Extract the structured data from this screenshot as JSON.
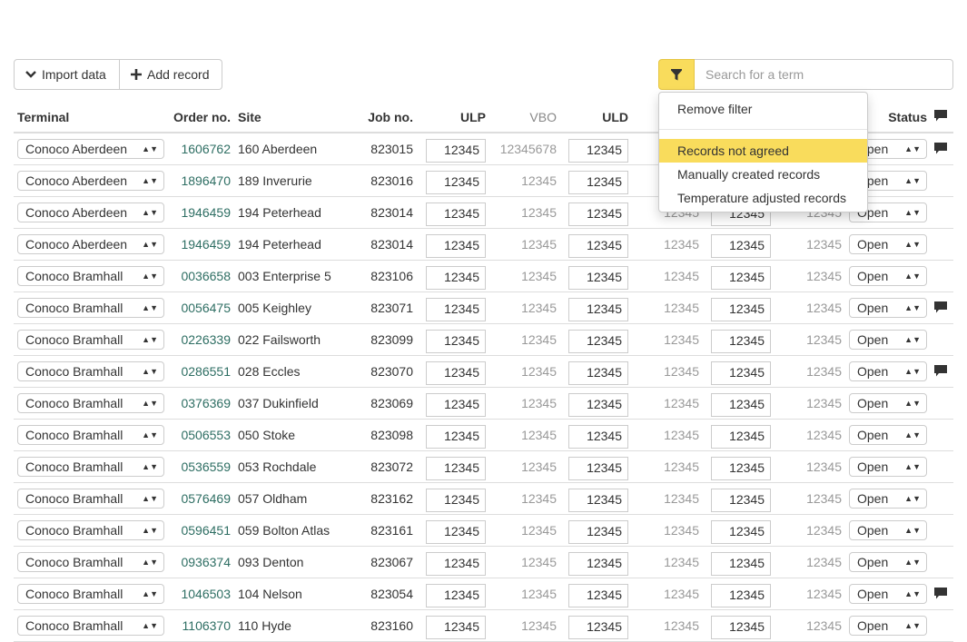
{
  "toolbar": {
    "import_label": "Import data",
    "add_label": "Add record"
  },
  "search": {
    "placeholder": "Search for a term"
  },
  "filter_menu": {
    "remove": "Remove filter",
    "options": [
      "Records not agreed",
      "Manually created records",
      "Temperature adjusted records"
    ],
    "active_option": "Records not agreed"
  },
  "columns": {
    "terminal": "Terminal",
    "order": "Order no.",
    "site": "Site",
    "job": "Job no.",
    "ulp": "ULP",
    "vbo": "VBO",
    "uld": "ULD",
    "status": "Status"
  },
  "colors": {
    "accent": "#f9dc5c",
    "order_link": "#2e6e63"
  },
  "rows": [
    {
      "terminal": "Conoco Aberdeen",
      "order": "1606762",
      "site": "160 Aberdeen",
      "job": "823015",
      "ulp": "12345",
      "vbo": "12345678",
      "uld": "12345",
      "c4": "12345",
      "c5": "12345",
      "c6": "12345",
      "status": "Open",
      "comment": true
    },
    {
      "terminal": "Conoco Aberdeen",
      "order": "1896470",
      "site": "189 Inverurie",
      "job": "823016",
      "ulp": "12345",
      "vbo": "12345",
      "uld": "12345",
      "c4": "12345",
      "c5": "12345",
      "c6": "12345",
      "status": "Open",
      "comment": false
    },
    {
      "terminal": "Conoco Aberdeen",
      "order": "1946459",
      "site": "194 Peterhead",
      "job": "823014",
      "ulp": "12345",
      "vbo": "12345",
      "uld": "12345",
      "c4": "12345",
      "c5": "12345",
      "c6": "12345",
      "status": "Open",
      "comment": false
    },
    {
      "terminal": "Conoco Aberdeen",
      "order": "1946459",
      "site": "194 Peterhead",
      "job": "823014",
      "ulp": "12345",
      "vbo": "12345",
      "uld": "12345",
      "c4": "12345",
      "c5": "12345",
      "c6": "12345",
      "status": "Open",
      "comment": false
    },
    {
      "terminal": "Conoco Bramhall",
      "order": "0036658",
      "site": "003 Enterprise 5",
      "job": "823106",
      "ulp": "12345",
      "vbo": "12345",
      "uld": "12345",
      "c4": "12345",
      "c5": "12345",
      "c6": "12345",
      "status": "Open",
      "comment": false
    },
    {
      "terminal": "Conoco Bramhall",
      "order": "0056475",
      "site": "005 Keighley",
      "job": "823071",
      "ulp": "12345",
      "vbo": "12345",
      "uld": "12345",
      "c4": "12345",
      "c5": "12345",
      "c6": "12345",
      "status": "Open",
      "comment": true
    },
    {
      "terminal": "Conoco Bramhall",
      "order": "0226339",
      "site": "022 Failsworth",
      "job": "823099",
      "ulp": "12345",
      "vbo": "12345",
      "uld": "12345",
      "c4": "12345",
      "c5": "12345",
      "c6": "12345",
      "status": "Open",
      "comment": false
    },
    {
      "terminal": "Conoco Bramhall",
      "order": "0286551",
      "site": "028 Eccles",
      "job": "823070",
      "ulp": "12345",
      "vbo": "12345",
      "uld": "12345",
      "c4": "12345",
      "c5": "12345",
      "c6": "12345",
      "status": "Open",
      "comment": true
    },
    {
      "terminal": "Conoco Bramhall",
      "order": "0376369",
      "site": "037 Dukinfield",
      "job": "823069",
      "ulp": "12345",
      "vbo": "12345",
      "uld": "12345",
      "c4": "12345",
      "c5": "12345",
      "c6": "12345",
      "status": "Open",
      "comment": false
    },
    {
      "terminal": "Conoco Bramhall",
      "order": "0506553",
      "site": "050 Stoke",
      "job": "823098",
      "ulp": "12345",
      "vbo": "12345",
      "uld": "12345",
      "c4": "12345",
      "c5": "12345",
      "c6": "12345",
      "status": "Open",
      "comment": false
    },
    {
      "terminal": "Conoco Bramhall",
      "order": "0536559",
      "site": "053 Rochdale",
      "job": "823072",
      "ulp": "12345",
      "vbo": "12345",
      "uld": "12345",
      "c4": "12345",
      "c5": "12345",
      "c6": "12345",
      "status": "Open",
      "comment": false
    },
    {
      "terminal": "Conoco Bramhall",
      "order": "0576469",
      "site": "057 Oldham",
      "job": "823162",
      "ulp": "12345",
      "vbo": "12345",
      "uld": "12345",
      "c4": "12345",
      "c5": "12345",
      "c6": "12345",
      "status": "Open",
      "comment": false
    },
    {
      "terminal": "Conoco Bramhall",
      "order": "0596451",
      "site": "059 Bolton Atlas",
      "job": "823161",
      "ulp": "12345",
      "vbo": "12345",
      "uld": "12345",
      "c4": "12345",
      "c5": "12345",
      "c6": "12345",
      "status": "Open",
      "comment": false
    },
    {
      "terminal": "Conoco Bramhall",
      "order": "0936374",
      "site": "093 Denton",
      "job": "823067",
      "ulp": "12345",
      "vbo": "12345",
      "uld": "12345",
      "c4": "12345",
      "c5": "12345",
      "c6": "12345",
      "status": "Open",
      "comment": false
    },
    {
      "terminal": "Conoco Bramhall",
      "order": "1046503",
      "site": "104 Nelson",
      "job": "823054",
      "ulp": "12345",
      "vbo": "12345",
      "uld": "12345",
      "c4": "12345",
      "c5": "12345",
      "c6": "12345",
      "status": "Open",
      "comment": true
    },
    {
      "terminal": "Conoco Bramhall",
      "order": "1106370",
      "site": "110 Hyde",
      "job": "823160",
      "ulp": "12345",
      "vbo": "12345",
      "uld": "12345",
      "c4": "12345",
      "c5": "12345",
      "c6": "12345",
      "status": "Open",
      "comment": false
    }
  ]
}
